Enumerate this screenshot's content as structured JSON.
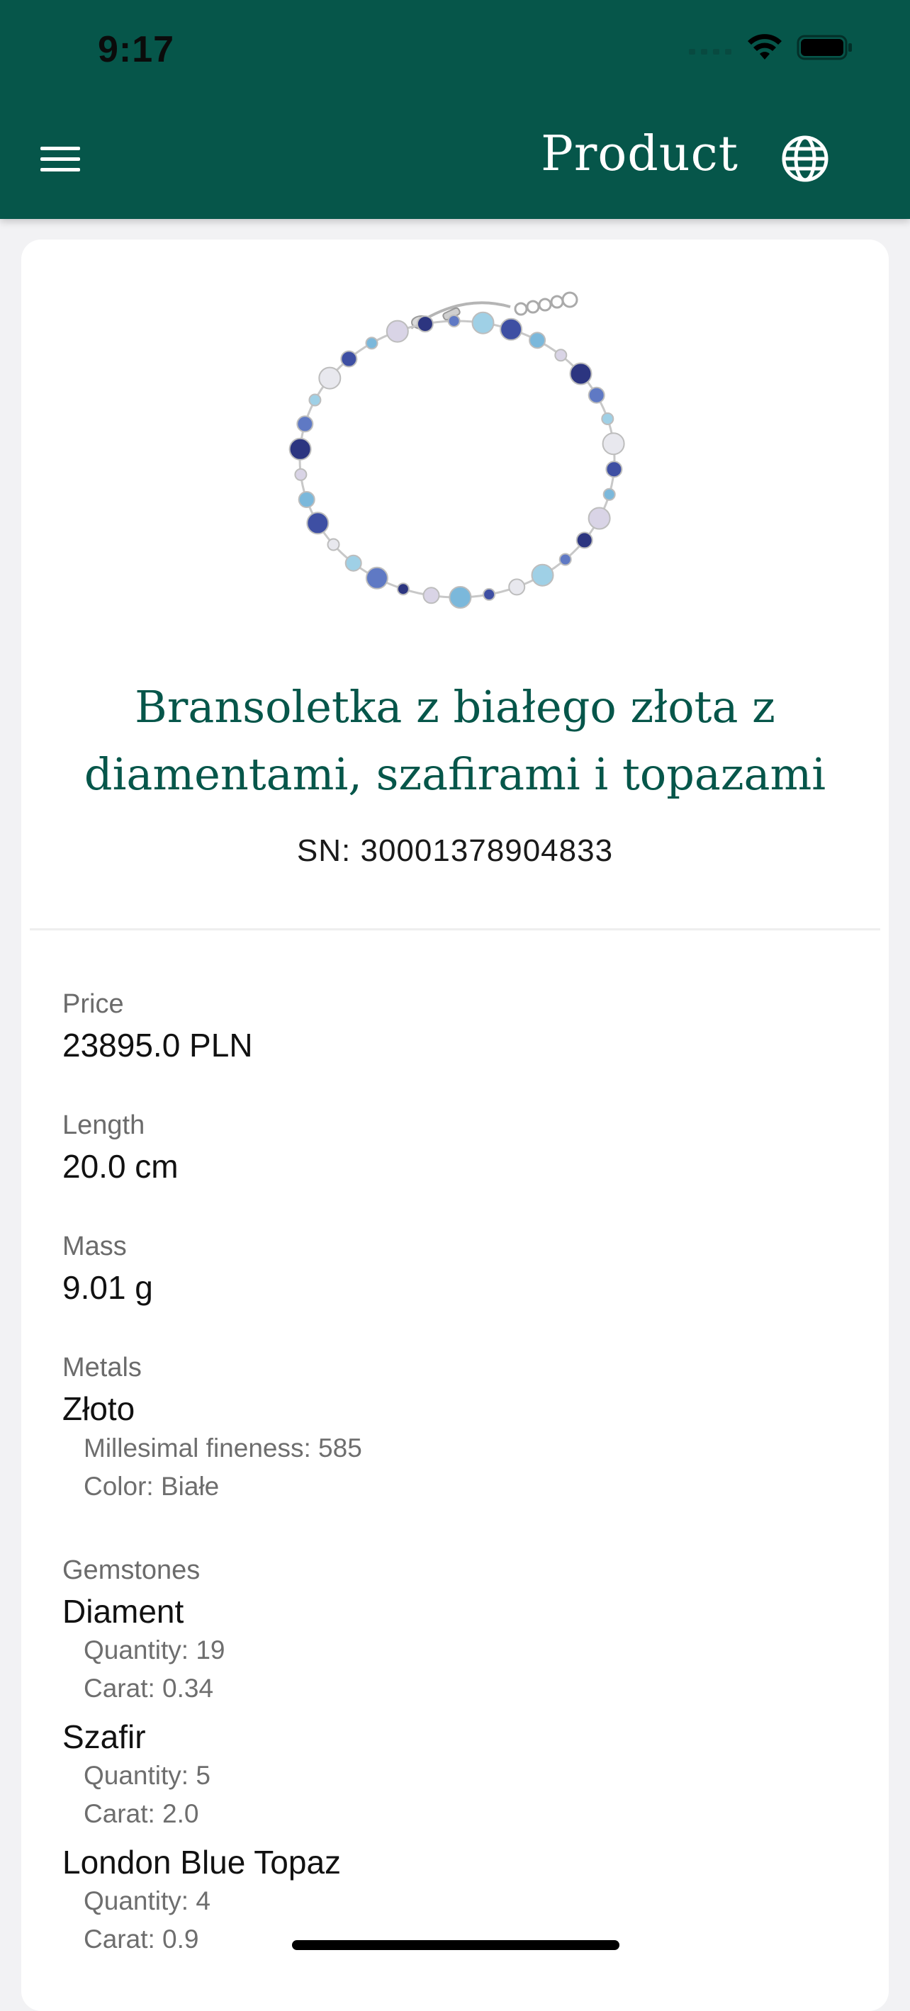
{
  "status_bar": {
    "time": "9:17"
  },
  "header": {
    "title": "Product",
    "menu_icon": "hamburger-menu-icon",
    "language_icon": "globe-icon"
  },
  "colors": {
    "brand_green": "#06564a",
    "page_background": "#f2f2f4",
    "card_background": "#ffffff"
  },
  "product": {
    "name_line1": "Bransoletka z białego złota z",
    "name_line2": "diamentami, szafirami i topazami",
    "sn": "SN: 30001378904833",
    "image_icon": "bracelet-image"
  },
  "details": {
    "price": {
      "label": "Price",
      "value": "23895.0 PLN"
    },
    "length": {
      "label": "Length",
      "value": "20.0 cm"
    },
    "mass": {
      "label": "Mass",
      "value": "9.01 g"
    },
    "metals": {
      "label": "Metals",
      "items": [
        {
          "name": "Złoto",
          "fineness": "Millesimal fineness: 585",
          "color": "Color: Białe"
        }
      ]
    },
    "gemstones": {
      "label": "Gemstones",
      "items": [
        {
          "name": "Diament",
          "quantity": "Quantity: 19",
          "carat": "Carat: 0.34"
        },
        {
          "name": "Szafir",
          "quantity": "Quantity: 5",
          "carat": "Carat: 2.0"
        },
        {
          "name": "London Blue Topaz",
          "quantity": "Quantity: 4",
          "carat": "Carat: 0.9"
        }
      ]
    }
  }
}
